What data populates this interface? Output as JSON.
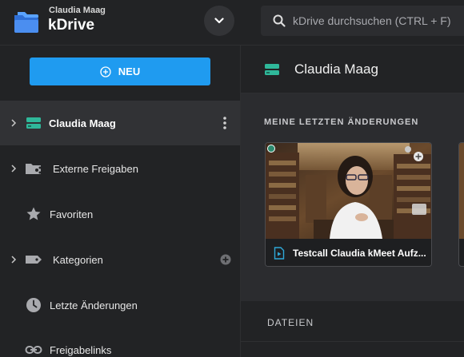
{
  "header": {
    "user_name": "Claudia Maag",
    "app_name": "kDrive",
    "search_placeholder": "kDrive durchsuchen (CTRL + F)"
  },
  "sidebar": {
    "new_button_label": "NEU",
    "items": [
      {
        "label": "Claudia Maag",
        "icon": "drive-icon",
        "expandable": true,
        "active": true
      },
      {
        "label": "Externe Freigaben",
        "icon": "shared-folder-icon",
        "expandable": true
      },
      {
        "label": "Favoriten",
        "icon": "star-icon",
        "expandable": false
      },
      {
        "label": "Kategorien",
        "icon": "tag-icon",
        "expandable": true
      },
      {
        "label": "Letzte Änderungen",
        "icon": "clock-icon",
        "expandable": false
      },
      {
        "label": "Freigabelinks",
        "icon": "link-icon",
        "expandable": false
      }
    ]
  },
  "main": {
    "title": "Claudia Maag",
    "recent_title": "MEINE LETZTEN ÄNDERUNGEN",
    "recent_files": [
      {
        "name": "Testcall Claudia kMeet Aufz...",
        "type": "video"
      }
    ],
    "files_title": "DATEIEN"
  },
  "colors": {
    "accent": "#1f9bf0",
    "drive_green": "#2fb89a",
    "background": "#222325",
    "panel": "#2b2c2f"
  }
}
